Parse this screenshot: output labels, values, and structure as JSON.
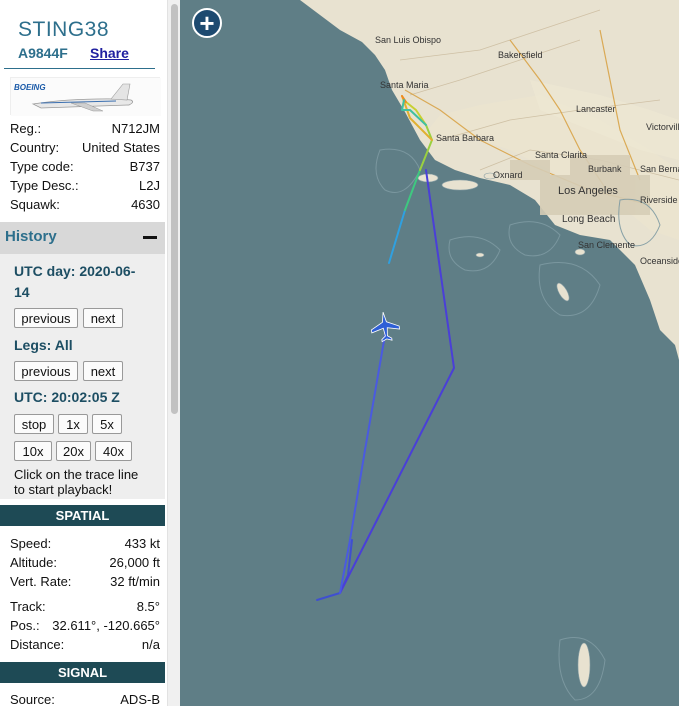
{
  "aircraft": {
    "callsign": "STING38",
    "hex": "A9844F",
    "share_label": "Share",
    "photo_brand": "BOEING"
  },
  "details": [
    {
      "label": "Reg.:",
      "value": "N712JM"
    },
    {
      "label": "Country:",
      "value": "United States"
    },
    {
      "label": "Type code:",
      "value": "B737"
    },
    {
      "label": "Type Desc.:",
      "value": "L2J"
    },
    {
      "label": "Squawk:",
      "value": "4630"
    }
  ],
  "history": {
    "title": "History",
    "utc_day_label": "UTC day: 2020-06-",
    "utc_day_label2": "14",
    "prev_label": "previous",
    "next_label": "next",
    "legs_label": "Legs: All",
    "utc_time_label": "UTC: 20:02:05 Z",
    "playback": [
      "stop",
      "1x",
      "5x",
      "10x",
      "20x",
      "40x"
    ],
    "hint_line1": "Click on the trace line",
    "hint_line2": "to start playback!"
  },
  "spatial": {
    "title": "SPATIAL",
    "rows": [
      {
        "label": "Speed:",
        "value": "433 kt"
      },
      {
        "label": "Altitude:",
        "value": "26,000 ft"
      },
      {
        "label": "Vert. Rate:",
        "value": "32 ft/min"
      },
      {
        "label": "Track:",
        "value": "8.5°"
      },
      {
        "label": "Pos.:",
        "value": "32.611°, -120.665°"
      },
      {
        "label": "Distance:",
        "value": "n/a"
      }
    ]
  },
  "signal": {
    "title": "SIGNAL",
    "rows": [
      {
        "label": "Source:",
        "value": "ADS-B"
      }
    ]
  },
  "map": {
    "zoom_label": "+",
    "cities": [
      "San Luis Obispo",
      "Bakersfield",
      "Santa Maria",
      "Lancaster",
      "Victorville",
      "Santa Barbara",
      "Santa Clarita",
      "Burbank",
      "San Bernardino",
      "Oxnard",
      "Los Angeles",
      "Riverside",
      "Long Beach",
      "San Clemente",
      "Oceanside"
    ],
    "ocean_color": "#5f7e86",
    "land_color": "#e8e2d0"
  }
}
